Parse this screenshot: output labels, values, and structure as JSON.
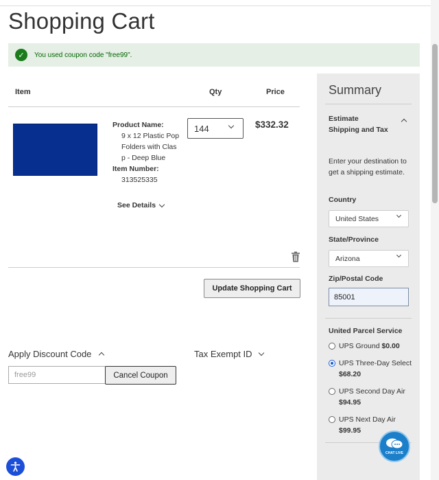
{
  "page": {
    "title": "Shopping Cart"
  },
  "notice": {
    "message": "You used coupon code \"free99\"."
  },
  "cart": {
    "headers": {
      "item": "Item",
      "qty": "Qty",
      "price": "Price"
    },
    "items": [
      {
        "product_name_label": "Product Name:",
        "product_name": "9 x 12 Plastic Pop Folders with Clasp - Deep Blue",
        "item_number_label": "Item Number:",
        "item_number": "313525335",
        "see_details": "See Details",
        "qty": "144",
        "price": "$332.32",
        "image_color": "#072f8f"
      }
    ],
    "update_button": "Update Shopping Cart"
  },
  "discount": {
    "title": "Apply Discount Code",
    "input_value": "free99",
    "cancel_button": "Cancel Coupon"
  },
  "tax_exempt": {
    "title": "Tax Exempt ID"
  },
  "summary": {
    "title": "Summary",
    "estimate_title": "Estimate Shipping and Tax",
    "estimate_text": "Enter your destination to get a shipping estimate.",
    "country_label": "Country",
    "country_value": "United States",
    "state_label": "State/Province",
    "state_value": "Arizona",
    "zip_label": "Zip/Postal Code",
    "zip_value": "85001",
    "carrier_title": "United Parcel Service",
    "options": [
      {
        "name": "UPS Ground",
        "price": "$0.00",
        "selected": false
      },
      {
        "name": "UPS Three-Day Select",
        "price": "$68.20",
        "selected": true
      },
      {
        "name": "UPS Second Day Air",
        "price": "$94.95",
        "selected": false
      },
      {
        "name": "UPS Next Day Air",
        "price": "$99.95",
        "selected": false
      }
    ]
  },
  "chat": {
    "label": "CHAT LIVE"
  },
  "colors": {
    "accent_blue": "#1c4fd8",
    "success_green": "#1a7c1a",
    "summary_bg": "#ebebeb"
  }
}
